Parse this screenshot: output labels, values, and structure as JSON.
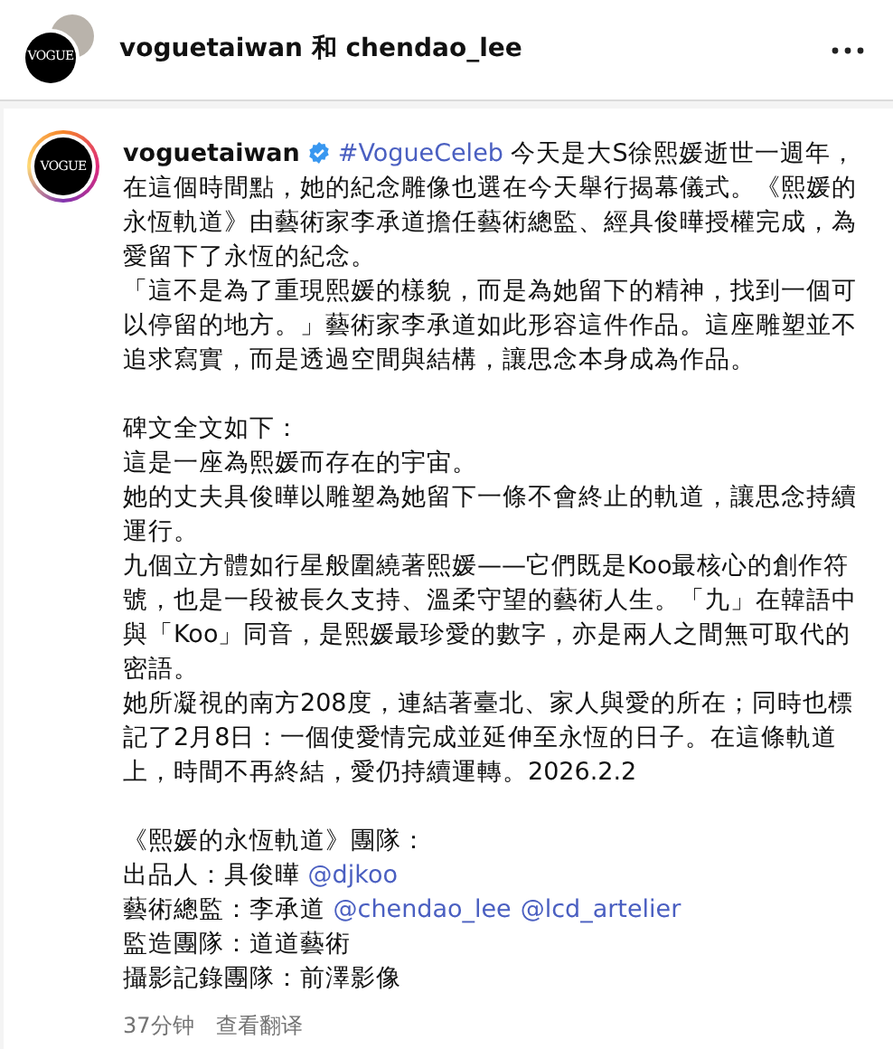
{
  "header": {
    "title": "voguetaiwan 和 chendao_lee",
    "logo": {
      "name": "VOGUE"
    }
  },
  "post": {
    "author": "voguetaiwan",
    "verified": true,
    "logo": {
      "name": "VOGUE"
    },
    "blocks": [
      [
        [
          {
            "kind": "author"
          },
          {
            "kind": "link",
            "text": "#VogueCeleb"
          },
          {
            "kind": "text",
            "text": " 今天是大S徐熙媛逝世一週年，在這個時間點，她的紀念雕像也選在今天舉行揭幕儀式。《熙媛的永恆軌道》由藝術家李承道擔任藝術總監、經具俊曄授權完成，為愛留下了永恆的紀念。"
          }
        ],
        [
          {
            "kind": "text",
            "text": "「這不是為了重現熙媛的樣貌，而是為她留下的精神，找到一個可以停留的地方。」藝術家李承道如此形容這件作品。這座雕塑並不追求寫實，而是透過空間與結構，讓思念本身成為作品。"
          }
        ]
      ],
      [
        [
          {
            "kind": "text",
            "text": "碑文全文如下："
          }
        ],
        [
          {
            "kind": "text",
            "text": "這是一座為熙媛而存在的宇宙。"
          }
        ],
        [
          {
            "kind": "text",
            "text": "她的丈夫具俊曄以雕塑為她留下一條不會終止的軌道，讓思念持續運行。"
          }
        ],
        [
          {
            "kind": "text",
            "text": "九個立方體如行星般圍繞著熙媛——它們既是Koo最核心的創作符號，也是一段被長久支持、溫柔守望的藝術人生。「九」在韓語中與「Koo」同音，是熙媛最珍愛的數字，亦是兩人之間無可取代的密語。"
          }
        ],
        [
          {
            "kind": "text",
            "text": "她所凝視的南方208度，連結著臺北、家人與愛的所在；同時也標記了2月8日：一個使愛情完成並延伸至永恆的日子。在這條軌道上，時間不再終結，愛仍持續運轉。2026.2.2"
          }
        ]
      ],
      [
        [
          {
            "kind": "text",
            "text": "《熙媛的永恆軌道》團隊："
          }
        ],
        [
          {
            "kind": "text",
            "text": "出品人：具俊曄 "
          },
          {
            "kind": "link",
            "text": "@djkoo"
          }
        ],
        [
          {
            "kind": "text",
            "text": "藝術總監：李承道 "
          },
          {
            "kind": "link",
            "text": "@chendao_lee"
          },
          {
            "kind": "link",
            "text": "@lcd_artelier"
          }
        ],
        [
          {
            "kind": "text",
            "text": "監造團隊：道道藝術"
          }
        ],
        [
          {
            "kind": "text",
            "text": "攝影記錄團隊：前澤影像"
          }
        ]
      ]
    ],
    "time": "37分钟",
    "translate": "查看翻译"
  }
}
